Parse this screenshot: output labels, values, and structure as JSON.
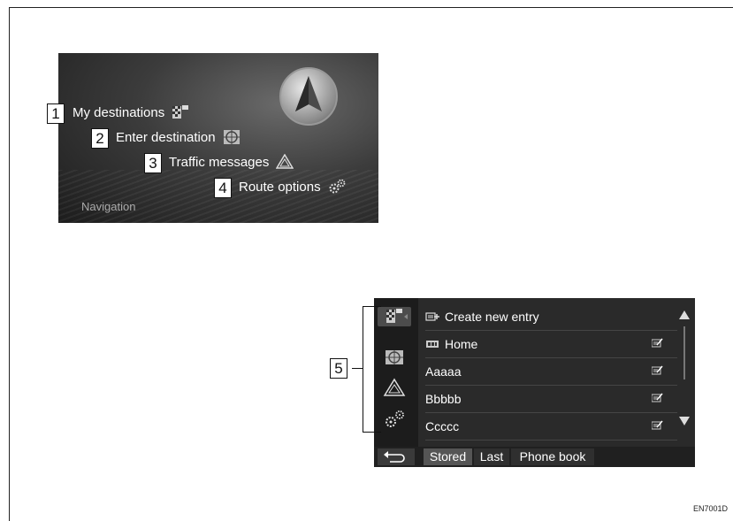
{
  "nav_menu": {
    "items": [
      {
        "number": "1",
        "label": "My destinations",
        "icon": "checkered-flag-icon"
      },
      {
        "number": "2",
        "label": "Enter destination",
        "icon": "map-target-icon"
      },
      {
        "number": "3",
        "label": "Traffic messages",
        "icon": "traffic-warning-icon"
      },
      {
        "number": "4",
        "label": "Route options",
        "icon": "gears-icon"
      }
    ],
    "caption": "Navigation"
  },
  "destinations": {
    "callout_number": "5",
    "rows": [
      {
        "label": "Create new entry",
        "icon": "new-entry-icon"
      },
      {
        "label": "Home",
        "icon": "home-icon"
      },
      {
        "label": "Aaaaa"
      },
      {
        "label": "Bbbbb"
      },
      {
        "label": "Ccccc"
      }
    ],
    "tabs": [
      {
        "label": "Stored"
      },
      {
        "label": "Last"
      },
      {
        "label": "Phone book"
      }
    ]
  },
  "doc_code": "EN7001D"
}
